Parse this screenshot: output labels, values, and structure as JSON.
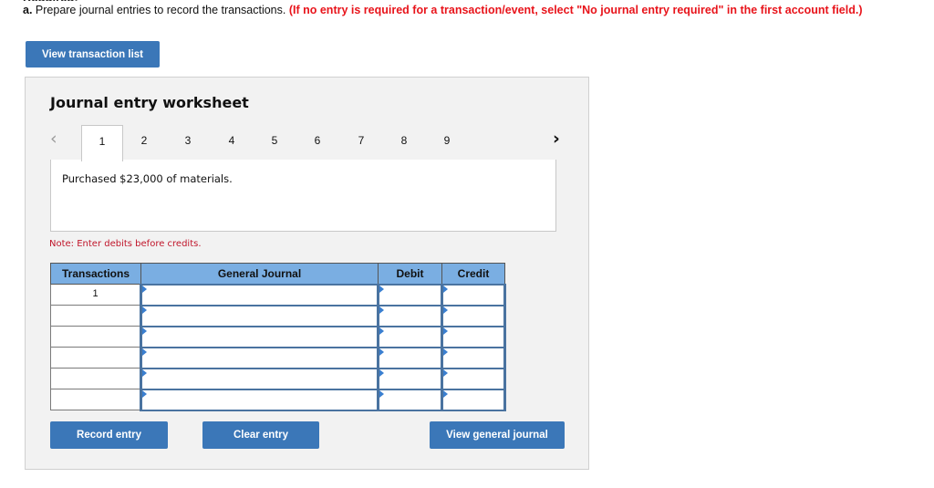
{
  "header": {
    "required_label": "Required:",
    "instruction_lead": "a.",
    "instruction_text": " Prepare journal entries to record the transactions. ",
    "instruction_warning": "(If no entry is required for a transaction/event, select \"No journal entry required\" in the first account field.)"
  },
  "buttons": {
    "view_transaction_list": "View transaction list",
    "record_entry": "Record entry",
    "clear_entry": "Clear entry",
    "view_general_journal": "View general journal"
  },
  "worksheet": {
    "title": "Journal entry worksheet",
    "prev_icon": "‹",
    "next_icon": "›",
    "tabs": [
      "1",
      "2",
      "3",
      "4",
      "5",
      "6",
      "7",
      "8",
      "9"
    ],
    "active_tab": "1",
    "description": "Purchased $23,000 of materials.",
    "note": "Note: Enter debits before credits."
  },
  "table": {
    "headers": [
      "Transactions",
      "General Journal",
      "Debit",
      "Credit"
    ],
    "rows": [
      {
        "transaction": "1",
        "account": "",
        "debit": "",
        "credit": ""
      },
      {
        "transaction": "",
        "account": "",
        "debit": "",
        "credit": ""
      },
      {
        "transaction": "",
        "account": "",
        "debit": "",
        "credit": ""
      },
      {
        "transaction": "",
        "account": "",
        "debit": "",
        "credit": ""
      },
      {
        "transaction": "",
        "account": "",
        "debit": "",
        "credit": ""
      },
      {
        "transaction": "",
        "account": "",
        "debit": "",
        "credit": ""
      }
    ]
  },
  "colors": {
    "button_blue": "#3b77b8",
    "header_blue": "#7aaee2",
    "warning_red": "#e8141b",
    "note_red": "#c0152a"
  }
}
